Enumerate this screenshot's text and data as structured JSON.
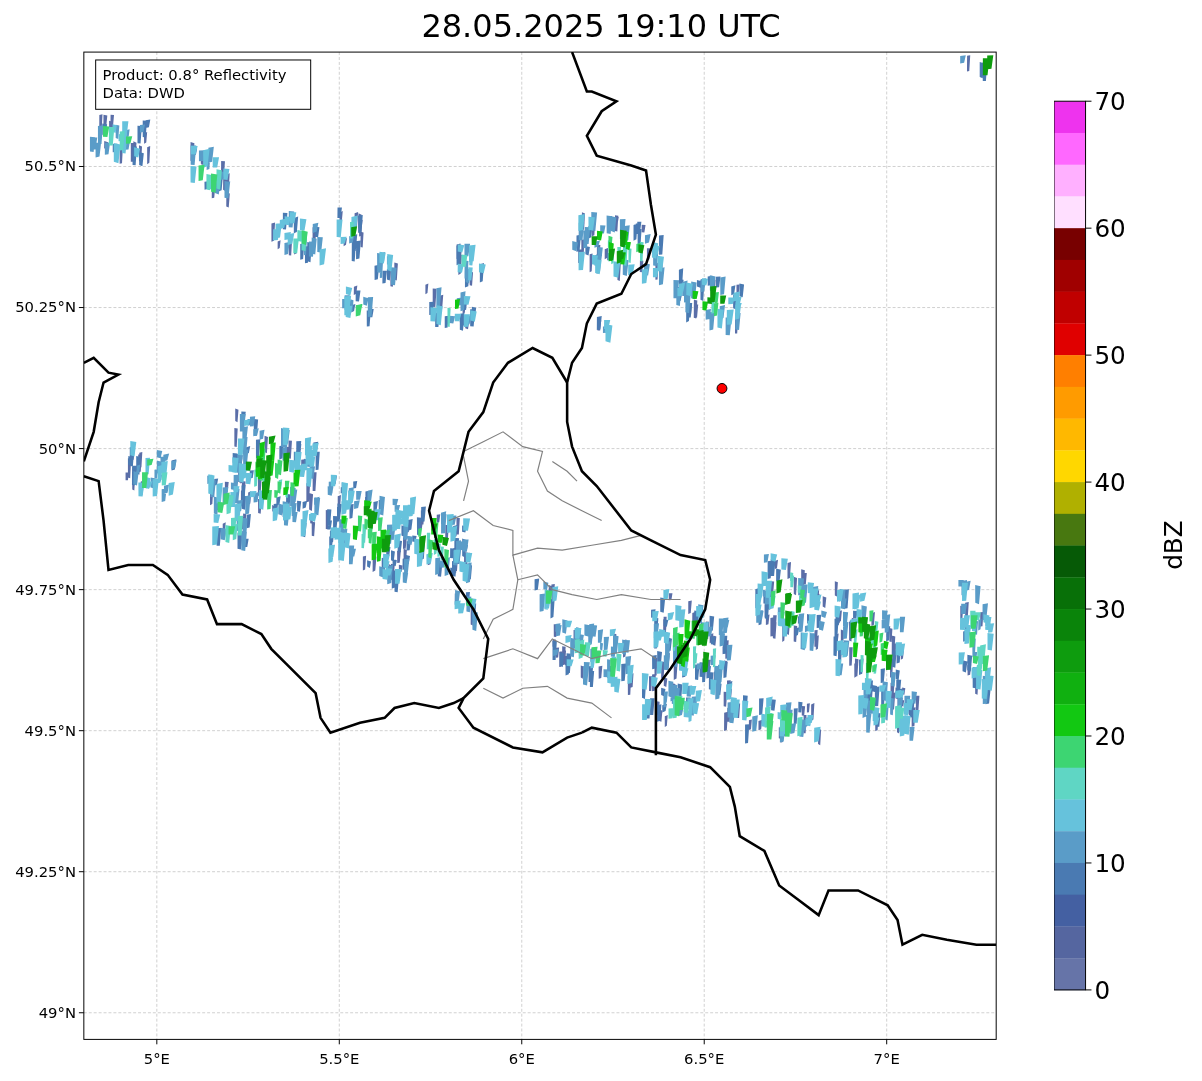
{
  "title": "28.05.2025 19:10 UTC",
  "legend": [
    "Product: 0.8° Reflectivity",
    "Data: DWD"
  ],
  "map": {
    "y_ticks": [
      "50.5°N",
      "50.25°N",
      "50°N",
      "49.75°N",
      "49.5°N",
      "49.25°N",
      "49°N"
    ],
    "x_ticks": [
      "5°E",
      "5.5°E",
      "6°E",
      "6.5°E",
      "7°E"
    ]
  },
  "colorbar": {
    "label": "dBZ",
    "ticks": [
      "70",
      "60",
      "50",
      "40",
      "30",
      "20",
      "10",
      "0"
    ],
    "segments": [
      {
        "color": "#ee33ee"
      },
      {
        "color": "#ff68ff"
      },
      {
        "color": "#ffb0ff"
      },
      {
        "color": "#ffdfff"
      },
      {
        "color": "#780000"
      },
      {
        "color": "#a00000"
      },
      {
        "color": "#c00000"
      },
      {
        "color": "#e00000"
      },
      {
        "color": "#ff7f00"
      },
      {
        "color": "#ff9b00"
      },
      {
        "color": "#ffb800"
      },
      {
        "color": "#ffd700"
      },
      {
        "color": "#b0b000"
      },
      {
        "color": "#487810"
      },
      {
        "color": "#065a06"
      },
      {
        "color": "#087008"
      },
      {
        "color": "#0a840a"
      },
      {
        "color": "#0e9c0e"
      },
      {
        "color": "#10b010"
      },
      {
        "color": "#12c812"
      },
      {
        "color": "#3dd572"
      },
      {
        "color": "#5fd6c4"
      },
      {
        "color": "#66c2dc"
      },
      {
        "color": "#5a9cc8"
      },
      {
        "color": "#4a7ab2"
      },
      {
        "color": "#4460a2"
      },
      {
        "color": "#5566a0"
      },
      {
        "color": "#6674a8"
      }
    ]
  }
}
